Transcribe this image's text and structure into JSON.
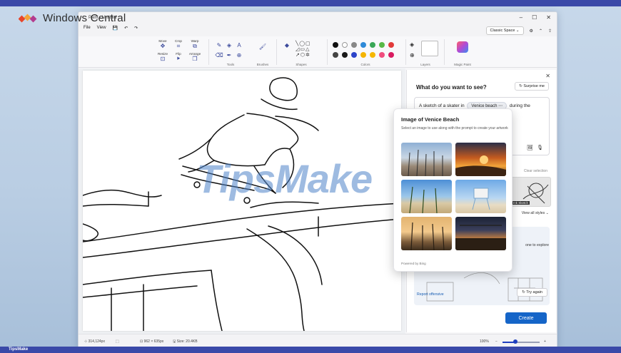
{
  "brand": {
    "name": "Windows Central",
    "accent": "#e8452a"
  },
  "footer_watermark": "TipsMake",
  "overlay_watermark": "TipsMake",
  "window": {
    "title": "Paint - Untitled",
    "menu": [
      "File",
      "View"
    ],
    "controls": [
      "–",
      "☐",
      "✕"
    ],
    "space_mode": "Classic Space"
  },
  "ribbon": {
    "groups": [
      {
        "label": "",
        "tools": [
          [
            "Move",
            "Crop",
            "Warp"
          ],
          [
            "Resize",
            "Flip",
            "Arrange"
          ]
        ]
      },
      {
        "label": "Tools"
      },
      {
        "label": "Brushes"
      },
      {
        "label": "Shapes"
      },
      {
        "label": "Colors"
      },
      {
        "label": "Layers"
      },
      {
        "label": "Magic Paint"
      }
    ],
    "colors_row1": [
      "#111111",
      "#ffffff",
      "#888888",
      "#2e8ad8",
      "#3aa757",
      "#58b947",
      "#e23a3a"
    ],
    "colors_row2": [
      "#444444",
      "#1a1a1a",
      "#2c44c9",
      "#f4b400",
      "#f5b700",
      "#f04d7e",
      "#d81b60"
    ]
  },
  "status": {
    "cursor": "314,124px",
    "size": "962 × 635px",
    "file_size": "Size: 20.4KB",
    "zoom": "100%",
    "zoom_level": 0.35
  },
  "panel": {
    "title": "What do you want to see?",
    "surprise": "Surprise me",
    "prompt_prefix": "A sketch of a skater in",
    "prompt_chip": "Venice beach",
    "prompt_suffix": "during the",
    "clear_selection": "Clear selection",
    "style_label": "Ink Sketch",
    "view_all": "View all styles",
    "explore": "one to explore",
    "report": "Report offensive",
    "try_again": "Try again",
    "create": "Create"
  },
  "popup": {
    "title": "Image of Venice Beach",
    "description": "Select an image to use along with the prompt to create your artwork",
    "powered_by": "Powered by Bing"
  }
}
